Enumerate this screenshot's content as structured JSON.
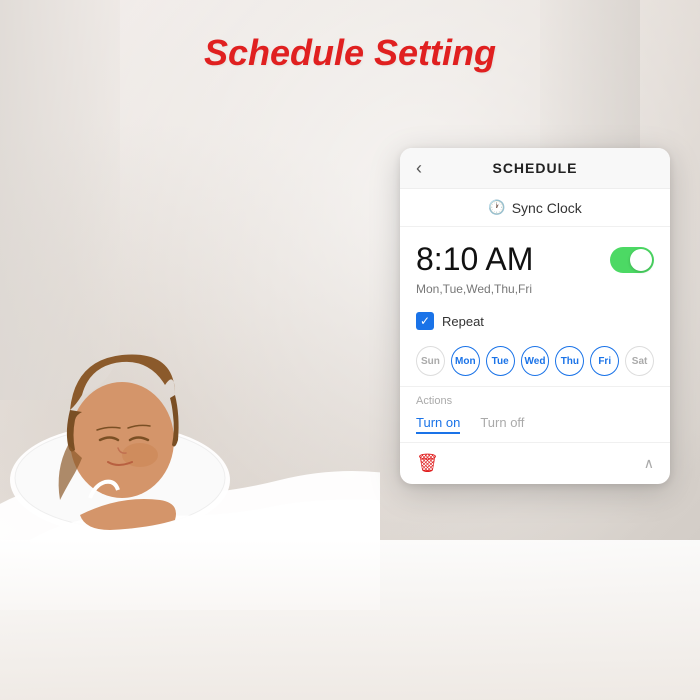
{
  "page": {
    "title": "Schedule Setting"
  },
  "card": {
    "back_icon": "‹",
    "header_title": "SCHEDULE",
    "sync_icon": "🕐",
    "sync_label": "Sync Clock",
    "time": "8:10 AM",
    "days_subtitle": "Mon,Tue,Wed,Thu,Fri",
    "toggle_on": true,
    "repeat_label": "Repeat",
    "days": [
      {
        "label": "Sun",
        "active": false
      },
      {
        "label": "Mon",
        "active": true
      },
      {
        "label": "Tue",
        "active": true
      },
      {
        "label": "Wed",
        "active": true
      },
      {
        "label": "Thu",
        "active": true
      },
      {
        "label": "Fri",
        "active": true
      },
      {
        "label": "Sat",
        "active": false
      }
    ],
    "actions_label": "Actions",
    "action_on": "Turn on",
    "action_off": "Turn off"
  }
}
